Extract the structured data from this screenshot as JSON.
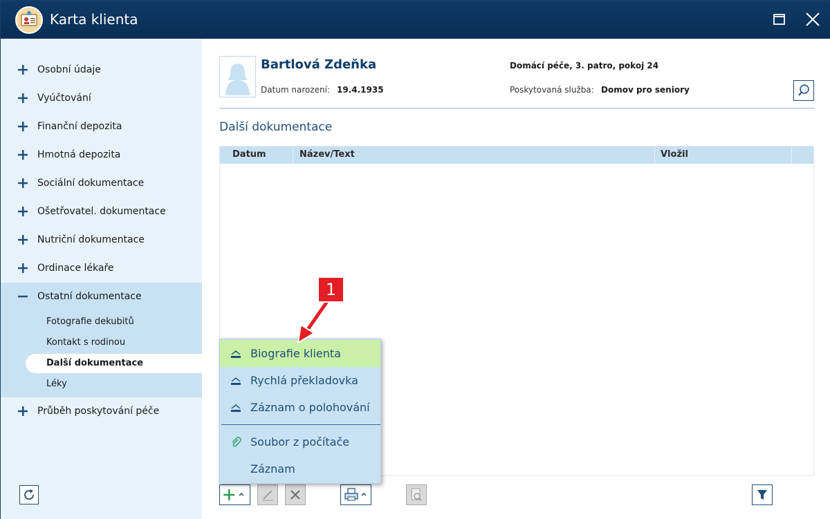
{
  "window": {
    "title": "Karta klienta"
  },
  "sidebar": {
    "items": [
      {
        "label": "Osobní údaje"
      },
      {
        "label": "Vyúčtování"
      },
      {
        "label": "Finanční depozita"
      },
      {
        "label": "Hmotná depozita"
      },
      {
        "label": "Sociální dokumentace"
      },
      {
        "label": "Ošetřovatel. dokumentace"
      },
      {
        "label": "Nutriční dokumentace"
      },
      {
        "label": "Ordinace lékaře"
      },
      {
        "label": "Ostatní dokumentace"
      },
      {
        "label": "Průběh poskytování péče"
      }
    ],
    "subitems": [
      {
        "label": "Fotografie dekubitů"
      },
      {
        "label": "Kontakt s rodinou"
      },
      {
        "label": "Další dokumentace"
      },
      {
        "label": "Léky"
      }
    ]
  },
  "client": {
    "name": "Bartlová Zdeňka",
    "dob_label": "Datum narození:",
    "dob_value": "19.4.1935",
    "place": "Domácí péče, 3. patro, pokoj 24",
    "service_label": "Poskytovaná služba:",
    "service_value": "Domov pro seniory"
  },
  "section": {
    "title": "Další dokumentace"
  },
  "grid": {
    "columns": [
      "Datum",
      "Název/Text",
      "Vložil"
    ]
  },
  "popup": {
    "items": [
      {
        "label": "Biografie klienta"
      },
      {
        "label": "Rychlá překladovka"
      },
      {
        "label": "Záznam o polohování"
      },
      {
        "label": "Soubor z počítače"
      },
      {
        "label": "Záznam"
      }
    ]
  },
  "callout": {
    "number": "1"
  },
  "colors": {
    "accent": "#1f4e78",
    "highlight": "#c9f0a6",
    "callout": "#e31e24"
  }
}
